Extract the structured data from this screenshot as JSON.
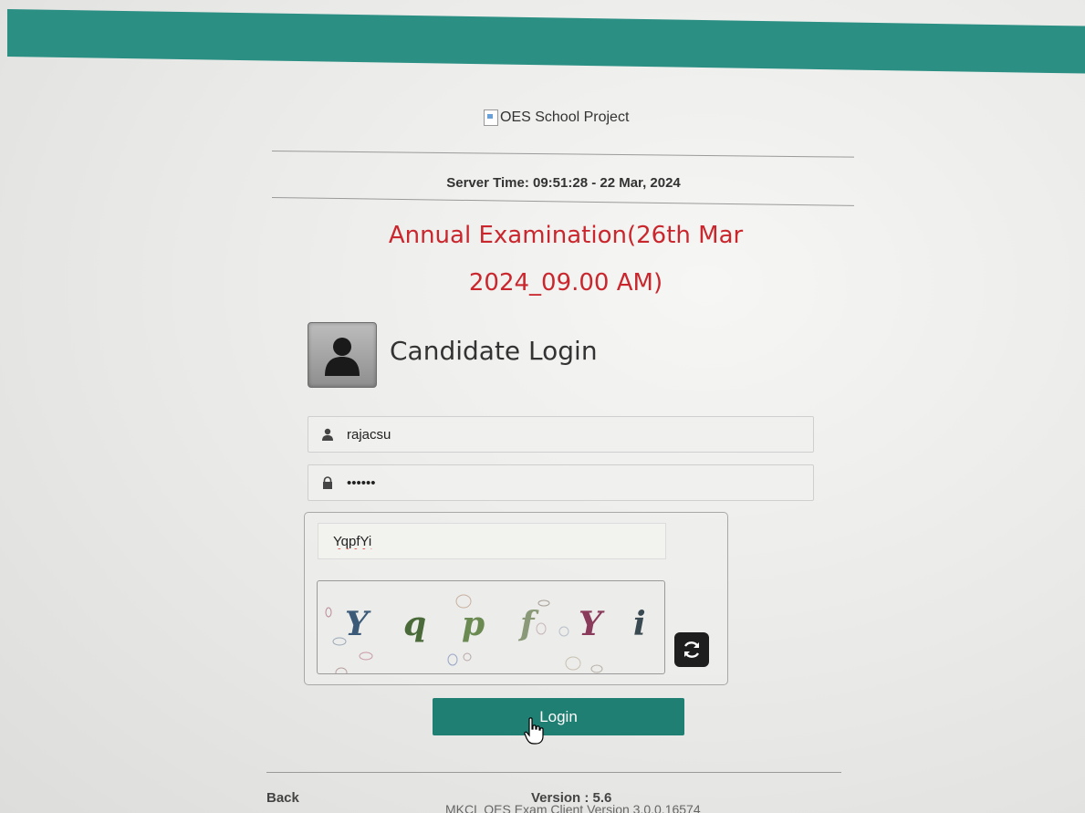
{
  "header": {
    "logo_alt": "OES School Project",
    "server_time": "Server Time: 09:51:28 - 22 Mar, 2024"
  },
  "exam": {
    "title_line1": "Annual Examination(26th Mar",
    "title_line2": "2024_09.00 AM)"
  },
  "login": {
    "heading": "Candidate Login",
    "username": "rajacsu",
    "password": "••••••",
    "captcha_input": "YqpfYi",
    "captcha_chars": [
      {
        "char": "Y",
        "color": "#3a5a78"
      },
      {
        "char": "q",
        "color": "#4a6a3a"
      },
      {
        "char": "p",
        "color": "#6a8a52"
      },
      {
        "char": "f",
        "color": "#8a9a78"
      },
      {
        "char": "Y",
        "color": "#8a3a5a"
      },
      {
        "char": "i",
        "color": "#3a4a52"
      }
    ],
    "button_label": "Login"
  },
  "footer": {
    "back_label": "Back",
    "version": "Version : 5.6",
    "client_version": "MKCL OES Exam Client Version 3.0.0.16574"
  },
  "colors": {
    "top_bar": "#2b8f84",
    "login_button": "#1f7f72",
    "exam_title": "#c9272d"
  }
}
